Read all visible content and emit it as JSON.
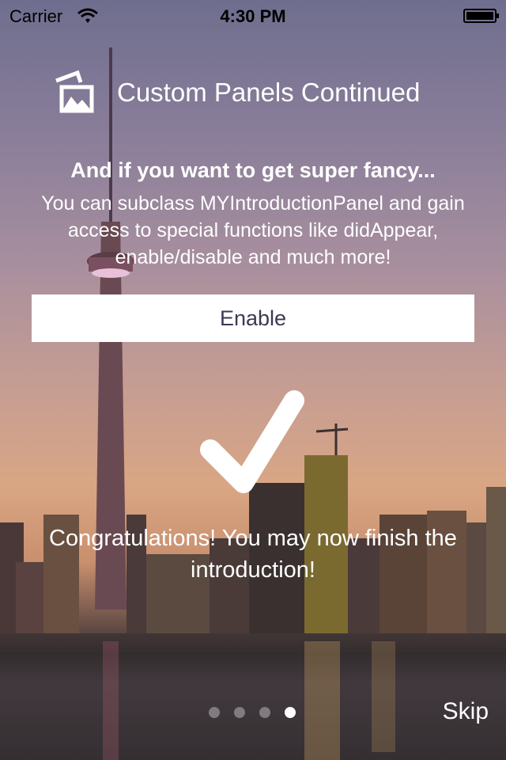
{
  "status_bar": {
    "carrier": "Carrier",
    "time": "4:30 PM"
  },
  "panel": {
    "title": "Custom Panels Continued",
    "subtitle": "And if you want to get super fancy...",
    "description": "You can subclass MYIntroductionPanel and gain access to special functions like didAppear, enable/disable and much more!",
    "enable_label": "Enable",
    "congrats": "Congratulations! You may now finish the introduction!"
  },
  "pager": {
    "page_count": 4,
    "current_page": 4
  },
  "skip_label": "Skip"
}
